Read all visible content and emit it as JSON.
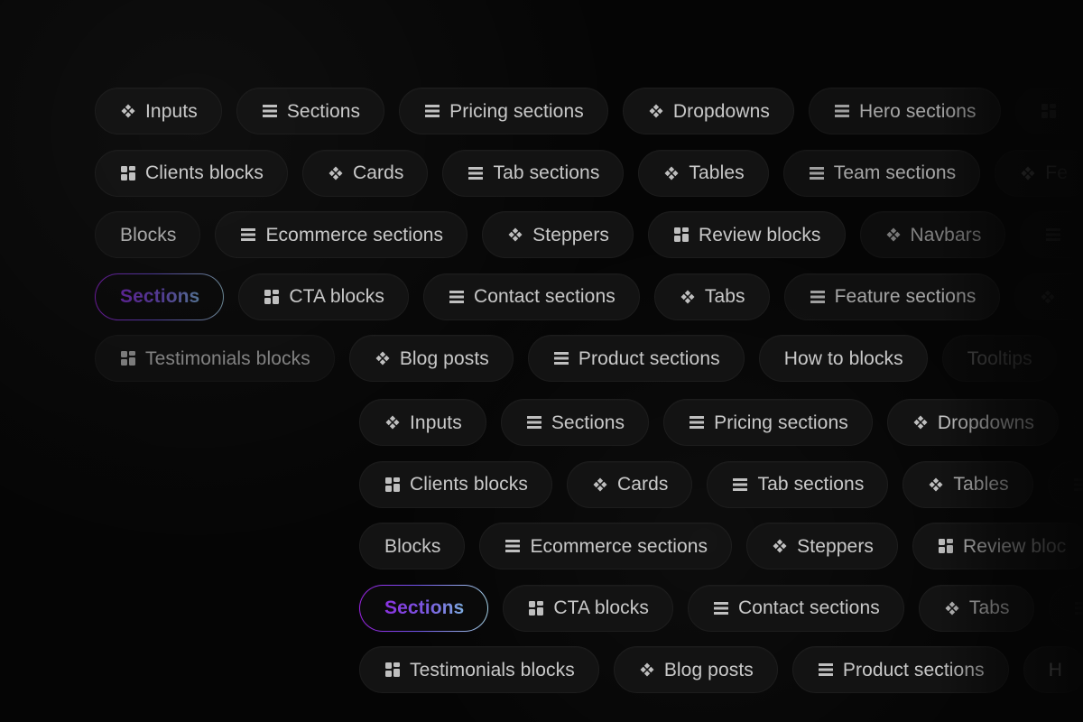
{
  "top_cluster": {
    "rows": [
      [
        {
          "label": "Inputs",
          "icon": "diamond-grid-icon",
          "state": "normal",
          "dim": 1
        },
        {
          "label": "Sections",
          "icon": "rows-icon",
          "state": "normal",
          "dim": 1
        },
        {
          "label": "Pricing sections",
          "icon": "rows-icon",
          "state": "normal",
          "dim": 1
        },
        {
          "label": "Dropdowns",
          "icon": "diamond-grid-icon",
          "state": "normal",
          "dim": 1
        },
        {
          "label": "Hero sections",
          "icon": "rows-icon",
          "state": "normal",
          "dim": 2
        },
        {
          "label": "",
          "icon": "tiles-icon",
          "state": "cutout",
          "dim": 5
        }
      ],
      [
        {
          "label": "Clients blocks",
          "icon": "tiles-icon",
          "state": "normal",
          "dim": 1
        },
        {
          "label": "Cards",
          "icon": "diamond-grid-icon",
          "state": "normal",
          "dim": 1
        },
        {
          "label": "Tab sections",
          "icon": "rows-icon",
          "state": "normal",
          "dim": 1
        },
        {
          "label": "Tables",
          "icon": "diamond-grid-icon",
          "state": "normal",
          "dim": 1
        },
        {
          "label": "Team sections",
          "icon": "rows-icon",
          "state": "normal",
          "dim": 2
        },
        {
          "label": "Fe",
          "icon": "diamond-grid-icon",
          "state": "normal",
          "dim": 4
        }
      ],
      [
        {
          "label": "Blocks",
          "icon": "",
          "state": "textonly",
          "dim": 2
        },
        {
          "label": "Ecommerce sections",
          "icon": "rows-icon",
          "state": "normal",
          "dim": 1
        },
        {
          "label": "Steppers",
          "icon": "diamond-grid-icon",
          "state": "normal",
          "dim": 1
        },
        {
          "label": "Review blocks",
          "icon": "tiles-icon",
          "state": "normal",
          "dim": 1
        },
        {
          "label": "Navbars",
          "icon": "diamond-grid-icon",
          "state": "normal",
          "dim": 3
        },
        {
          "label": "",
          "icon": "rows-icon",
          "state": "cutout",
          "dim": 5
        }
      ],
      [
        {
          "label": "Sections",
          "icon": "",
          "state": "active",
          "dim": 3
        },
        {
          "label": "CTA blocks",
          "icon": "tiles-icon",
          "state": "normal",
          "dim": 1
        },
        {
          "label": "Contact sections",
          "icon": "rows-icon",
          "state": "normal",
          "dim": 1
        },
        {
          "label": "Tabs",
          "icon": "diamond-grid-icon",
          "state": "normal",
          "dim": 1
        },
        {
          "label": "Feature sections",
          "icon": "rows-icon",
          "state": "normal",
          "dim": 2
        },
        {
          "label": "",
          "icon": "diamond-grid-icon",
          "state": "cutout",
          "dim": 5
        }
      ],
      [
        {
          "label": "Testimonials blocks",
          "icon": "tiles-icon",
          "state": "normal",
          "dim": 3
        },
        {
          "label": "Blog posts",
          "icon": "diamond-grid-icon",
          "state": "normal",
          "dim": 1
        },
        {
          "label": "Product sections",
          "icon": "rows-icon",
          "state": "normal",
          "dim": 1
        },
        {
          "label": "How to blocks",
          "icon": "",
          "state": "textonly",
          "dim": 1
        },
        {
          "label": "Tooltips",
          "icon": "",
          "state": "textonly",
          "dim": 4
        }
      ]
    ]
  },
  "bottom_cluster": {
    "rows": [
      [
        {
          "label": "Inputs",
          "icon": "diamond-grid-icon",
          "state": "normal",
          "dim": 1
        },
        {
          "label": "Sections",
          "icon": "rows-icon",
          "state": "normal",
          "dim": 1
        },
        {
          "label": "Pricing sections",
          "icon": "rows-icon",
          "state": "normal",
          "dim": 1
        },
        {
          "label": "Dropdowns",
          "icon": "diamond-grid-icon",
          "state": "normal",
          "dim": 1
        },
        {
          "label": "",
          "icon": "rows-icon",
          "state": "cutout",
          "dim": 5
        }
      ],
      [
        {
          "label": "Clients blocks",
          "icon": "tiles-icon",
          "state": "normal",
          "dim": 1
        },
        {
          "label": "Cards",
          "icon": "diamond-grid-icon",
          "state": "normal",
          "dim": 1
        },
        {
          "label": "Tab sections",
          "icon": "rows-icon",
          "state": "normal",
          "dim": 1
        },
        {
          "label": "Tables",
          "icon": "diamond-grid-icon",
          "state": "normal",
          "dim": 1
        },
        {
          "label": "",
          "icon": "rows-icon",
          "state": "cutout",
          "dim": 5
        }
      ],
      [
        {
          "label": "Blocks",
          "icon": "",
          "state": "textonly",
          "dim": 1
        },
        {
          "label": "Ecommerce sections",
          "icon": "rows-icon",
          "state": "normal",
          "dim": 1
        },
        {
          "label": "Steppers",
          "icon": "diamond-grid-icon",
          "state": "normal",
          "dim": 1
        },
        {
          "label": "Review bloc",
          "icon": "tiles-icon",
          "state": "normal",
          "dim": 1
        }
      ],
      [
        {
          "label": "Sections",
          "icon": "",
          "state": "active",
          "dim": 1
        },
        {
          "label": "CTA blocks",
          "icon": "tiles-icon",
          "state": "normal",
          "dim": 1
        },
        {
          "label": "Contact sections",
          "icon": "rows-icon",
          "state": "normal",
          "dim": 1
        },
        {
          "label": "Tabs",
          "icon": "diamond-grid-icon",
          "state": "normal",
          "dim": 1
        },
        {
          "label": "",
          "icon": "rows-icon",
          "state": "cutout",
          "dim": 5
        }
      ],
      [
        {
          "label": "Testimonials blocks",
          "icon": "tiles-icon",
          "state": "normal",
          "dim": 1
        },
        {
          "label": "Blog posts",
          "icon": "diamond-grid-icon",
          "state": "normal",
          "dim": 1
        },
        {
          "label": "Product sections",
          "icon": "rows-icon",
          "state": "normal",
          "dim": 1
        },
        {
          "label": "H",
          "icon": "",
          "state": "textonly",
          "dim": 1
        }
      ]
    ]
  },
  "colors": {
    "background": "#050505",
    "chip_background": "#151515",
    "chip_border": "#202020",
    "chip_text": "#e3e3e3",
    "active_gradient_start": "#b026ff",
    "active_gradient_mid": "#7b5cff",
    "active_gradient_end": "#b7ecff"
  }
}
